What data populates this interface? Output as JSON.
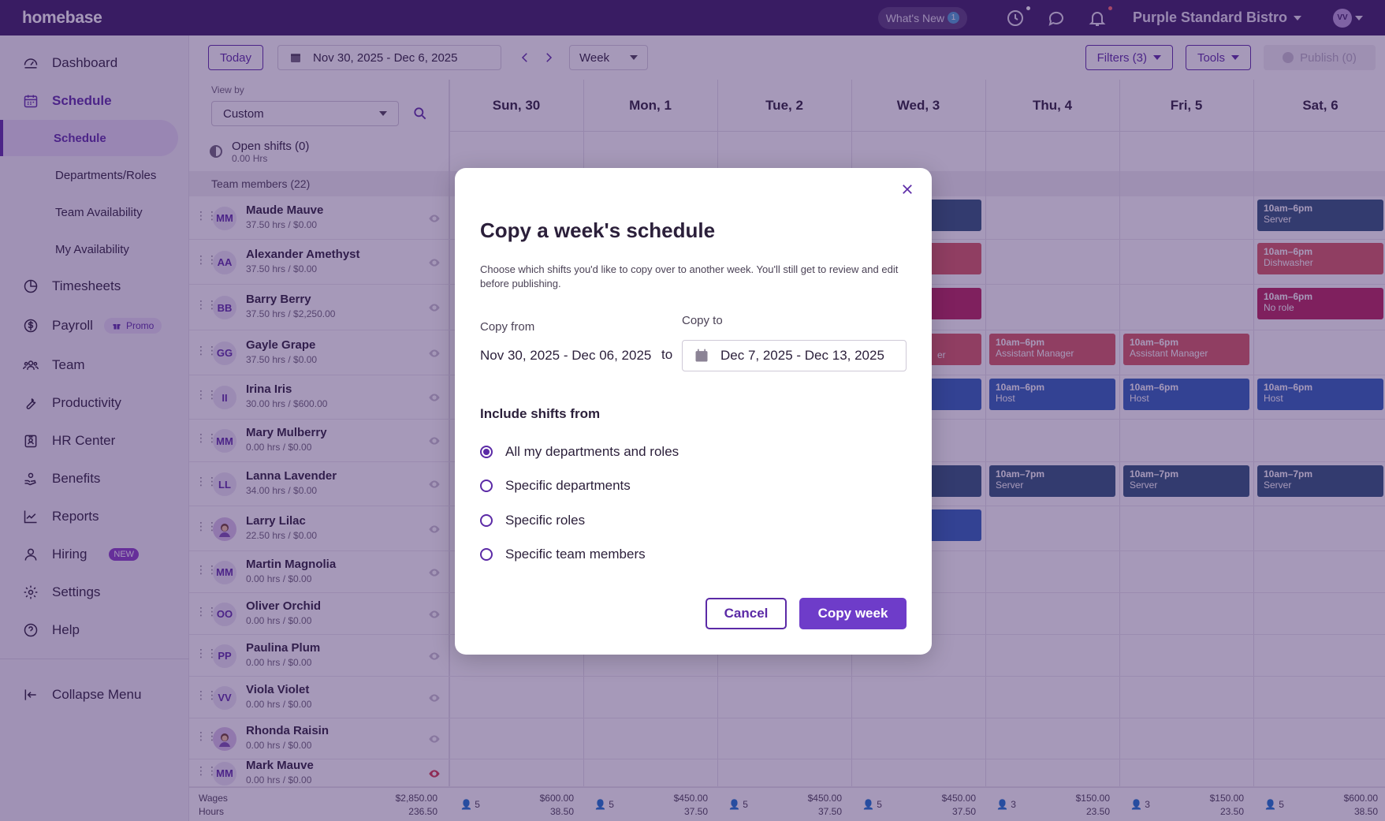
{
  "topbar": {
    "logo": "homebase",
    "whats_new": "What's New",
    "whats_new_count": "1",
    "location": "Purple Standard Bistro",
    "user_initials": "VV"
  },
  "sidebar": {
    "items": [
      {
        "label": "Dashboard",
        "icon": "dashboard-icon"
      },
      {
        "label": "Schedule",
        "icon": "calendar-icon"
      },
      {
        "label": "Timesheets",
        "icon": "clock-icon"
      },
      {
        "label": "Payroll",
        "icon": "dollar-icon",
        "badge": "Promo"
      },
      {
        "label": "Team",
        "icon": "team-icon"
      },
      {
        "label": "Productivity",
        "icon": "wrench-icon"
      },
      {
        "label": "HR Center",
        "icon": "id-badge-icon"
      },
      {
        "label": "Benefits",
        "icon": "hand-heart-icon"
      },
      {
        "label": "Reports",
        "icon": "chart-icon"
      },
      {
        "label": "Hiring",
        "icon": "person-icon",
        "badge": "NEW"
      },
      {
        "label": "Settings",
        "icon": "gear-icon"
      },
      {
        "label": "Help",
        "icon": "help-icon"
      }
    ],
    "sub_items": [
      "Schedule",
      "Departments/Roles",
      "Team Availability",
      "My Availability"
    ],
    "collapse": "Collapse Menu"
  },
  "toolbar": {
    "today": "Today",
    "date_range": "Nov 30, 2025 - Dec 6, 2025",
    "view": "Week",
    "filters": "Filters (3)",
    "tools": "Tools",
    "publish": "Publish (0)"
  },
  "grid": {
    "view_by_label": "View by",
    "view_by_value": "Custom",
    "open_shifts": "Open shifts (0)",
    "open_shifts_hrs": "0.00 Hrs",
    "team_label": "Team members (22)",
    "days": [
      "Sun, 30",
      "Mon, 1",
      "Tue, 2",
      "Wed, 3",
      "Thu, 4",
      "Fri, 5",
      "Sat, 6"
    ],
    "members": [
      {
        "initials": "MM",
        "name": "Maude Mauve",
        "hours": "37.50 hrs / $0.00"
      },
      {
        "initials": "AA",
        "name": "Alexander Amethyst",
        "hours": "37.50 hrs / $0.00"
      },
      {
        "initials": "BB",
        "name": "Barry Berry",
        "hours": "37.50 hrs / $2,250.00"
      },
      {
        "initials": "GG",
        "name": "Gayle Grape",
        "hours": "37.50 hrs / $0.00"
      },
      {
        "initials": "II",
        "name": "Irina Iris",
        "hours": "30.00 hrs / $600.00"
      },
      {
        "initials": "MM",
        "name": "Mary Mulberry",
        "hours": "0.00 hrs / $0.00"
      },
      {
        "initials": "LL",
        "name": "Lanna Lavender",
        "hours": "34.00 hrs / $0.00"
      },
      {
        "initials": "",
        "name": "Larry Lilac",
        "hours": "22.50 hrs / $0.00"
      },
      {
        "initials": "MM",
        "name": "Martin Magnolia",
        "hours": "0.00 hrs / $0.00"
      },
      {
        "initials": "OO",
        "name": "Oliver Orchid",
        "hours": "0.00 hrs / $0.00"
      },
      {
        "initials": "PP",
        "name": "Paulina Plum",
        "hours": "0.00 hrs / $0.00"
      },
      {
        "initials": "VV",
        "name": "Viola Violet",
        "hours": "0.00 hrs / $0.00"
      },
      {
        "initials": "",
        "name": "Rhonda Raisin",
        "hours": "0.00 hrs / $0.00"
      },
      {
        "initials": "MM",
        "name": "Mark Mauve",
        "hours": "0.00 hrs / $0.00"
      }
    ],
    "shifts": [
      {
        "time": "10am–6pm",
        "role": "Server",
        "color": "#2f5478"
      },
      {
        "time": "10am–6pm",
        "role": "Dishwasher",
        "color": "#d85a62"
      },
      {
        "time": "10am–6pm",
        "role": "No role",
        "color": "#b8245a"
      },
      {
        "time": "10am–6pm",
        "role": "Assistant Manager",
        "color": "#d85a62"
      },
      {
        "time": "10am–6pm",
        "role": "Assistant Manager",
        "color": "#d85a62"
      },
      {
        "time": "10am–6pm",
        "role": "Host",
        "color": "#2e62bb"
      },
      {
        "time": "10am–6pm",
        "role": "Host",
        "color": "#2e62bb"
      },
      {
        "time": "10am–6pm",
        "role": "Host",
        "color": "#2e62bb"
      },
      {
        "time": "10am–7pm",
        "role": "Server",
        "color": "#2f5478"
      },
      {
        "time": "10am–7pm",
        "role": "Server",
        "color": "#2f5478"
      },
      {
        "time": "10am–7pm",
        "role": "Server",
        "color": "#2f5478"
      }
    ],
    "partial_shift_label": "er",
    "footer": {
      "wages_label": "Wages",
      "hours_label": "Hours",
      "total_wages": "$2,850.00",
      "total_hours": "236.50",
      "days": [
        {
          "count": "5",
          "wages": "$600.00",
          "hours": "38.50"
        },
        {
          "count": "5",
          "wages": "$450.00",
          "hours": "37.50"
        },
        {
          "count": "5",
          "wages": "$450.00",
          "hours": "37.50"
        },
        {
          "count": "5",
          "wages": "$450.00",
          "hours": "37.50"
        },
        {
          "count": "3",
          "wages": "$150.00",
          "hours": "23.50"
        },
        {
          "count": "3",
          "wages": "$150.00",
          "hours": "23.50"
        },
        {
          "count": "5",
          "wages": "$600.00",
          "hours": "38.50"
        }
      ]
    }
  },
  "modal": {
    "title": "Copy a week's schedule",
    "description": "Choose which shifts you'd like to copy over to another week. You'll still get to review and edit before publishing.",
    "copy_from_label": "Copy from",
    "copy_from_value": "Nov 30, 2025 - Dec 06, 2025",
    "to": "to",
    "copy_to_label": "Copy to",
    "copy_to_value": "Dec 7, 2025 - Dec 13, 2025",
    "include_label": "Include shifts from",
    "options": [
      {
        "label": "All my departments and roles",
        "checked": true
      },
      {
        "label": "Specific departments",
        "checked": false
      },
      {
        "label": "Specific roles",
        "checked": false
      },
      {
        "label": "Specific team members",
        "checked": false
      }
    ],
    "cancel": "Cancel",
    "confirm": "Copy week"
  }
}
